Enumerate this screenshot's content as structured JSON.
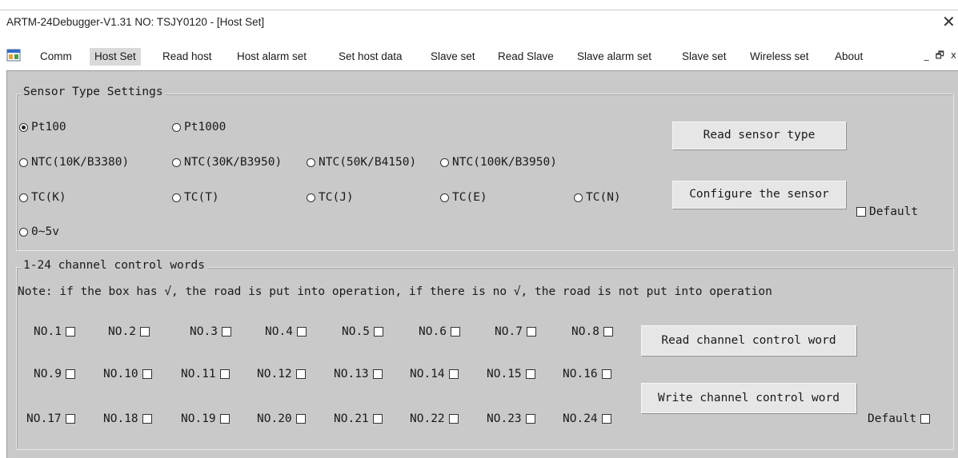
{
  "window": {
    "title": "ARTM-24Debugger-V1.31 NO: TSJY0120 - [Host Set]",
    "close_glyph": "✕"
  },
  "menu": {
    "app_icon": "app-window-icon",
    "items": [
      "Comm",
      "Host Set",
      "Read host",
      "Host alarm set",
      "Set host data",
      "Slave set",
      "Read Slave",
      "Slave alarm set",
      "Slave set",
      "Wireless set",
      "About"
    ],
    "active": "Host Set",
    "minimize_glyph": "_",
    "restore_glyph": "🗗",
    "close_glyph": "x"
  },
  "sensor_group": {
    "label": "Sensor Type Settings",
    "options": [
      "Pt100",
      "Pt1000",
      "NTC(10K/B3380)",
      "NTC(30K/B3950)",
      "NTC(50K/B4150)",
      "NTC(100K/B3950)",
      "TC(K)",
      "TC(T)",
      "TC(J)",
      "TC(E)",
      "TC(N)",
      "0~5v"
    ],
    "selected": "Pt100",
    "read_button": "Read sensor type",
    "configure_button": "Configure the sensor",
    "default_label": "Default"
  },
  "channel_group": {
    "label": "1-24 channel control words",
    "note": "Note: if the box has √, the road is put into operation, if there is no √, the road is not put into operation",
    "channels": [
      "NO.1",
      "NO.2",
      "NO.3",
      "NO.4",
      "NO.5",
      "NO.6",
      "NO.7",
      "NO.8",
      "NO.9",
      "NO.10",
      "NO.11",
      "NO.12",
      "NO.13",
      "NO.14",
      "NO.15",
      "NO.16",
      "NO.17",
      "NO.18",
      "NO.19",
      "NO.20",
      "NO.21",
      "NO.22",
      "NO.23",
      "NO.24"
    ],
    "read_button": "Read channel control word",
    "write_button": "Write channel control word",
    "default_label": "Default"
  },
  "colors": {
    "client_bg": "#c9c9c9",
    "button_bg": "#e6e6e6",
    "active_menu_bg": "#d9d9d9"
  }
}
